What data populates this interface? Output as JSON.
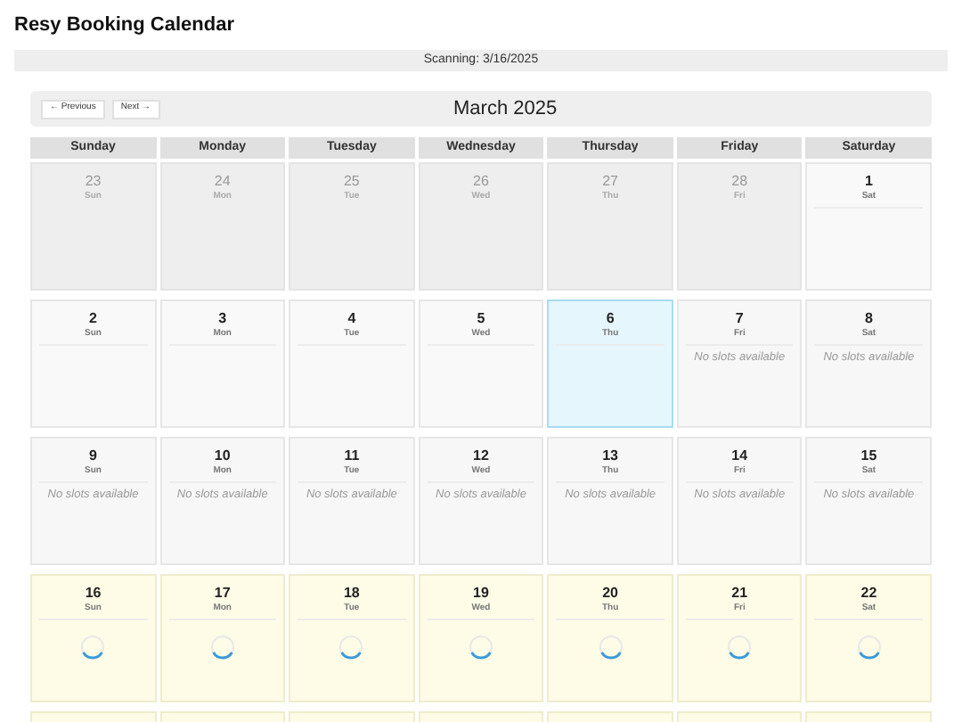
{
  "title": "Resy Booking Calendar",
  "status": "Scanning: 3/16/2025",
  "nav": {
    "previous": "← Previous",
    "next": "Next →",
    "month": "March 2025"
  },
  "weekdays": [
    "Sunday",
    "Monday",
    "Tuesday",
    "Wednesday",
    "Thursday",
    "Friday",
    "Saturday"
  ],
  "weeks": [
    [
      {
        "day": "23",
        "weekday": "Sun",
        "kind": "outside"
      },
      {
        "day": "24",
        "weekday": "Mon",
        "kind": "outside"
      },
      {
        "day": "25",
        "weekday": "Tue",
        "kind": "outside"
      },
      {
        "day": "26",
        "weekday": "Wed",
        "kind": "outside"
      },
      {
        "day": "27",
        "weekday": "Thu",
        "kind": "outside"
      },
      {
        "day": "28",
        "weekday": "Fri",
        "kind": "outside"
      },
      {
        "day": "1",
        "weekday": "Sat",
        "kind": "empty"
      }
    ],
    [
      {
        "day": "2",
        "weekday": "Sun",
        "kind": "empty"
      },
      {
        "day": "3",
        "weekday": "Mon",
        "kind": "empty"
      },
      {
        "day": "4",
        "weekday": "Tue",
        "kind": "empty"
      },
      {
        "day": "5",
        "weekday": "Wed",
        "kind": "empty"
      },
      {
        "day": "6",
        "weekday": "Thu",
        "kind": "today"
      },
      {
        "day": "7",
        "weekday": "Fri",
        "kind": "none",
        "note": "No slots available"
      },
      {
        "day": "8",
        "weekday": "Sat",
        "kind": "none",
        "note": "No slots available"
      }
    ],
    [
      {
        "day": "9",
        "weekday": "Sun",
        "kind": "none",
        "note": "No slots available"
      },
      {
        "day": "10",
        "weekday": "Mon",
        "kind": "none",
        "note": "No slots available"
      },
      {
        "day": "11",
        "weekday": "Tue",
        "kind": "none",
        "note": "No slots available"
      },
      {
        "day": "12",
        "weekday": "Wed",
        "kind": "none",
        "note": "No slots available"
      },
      {
        "day": "13",
        "weekday": "Thu",
        "kind": "none",
        "note": "No slots available"
      },
      {
        "day": "14",
        "weekday": "Fri",
        "kind": "none",
        "note": "No slots available"
      },
      {
        "day": "15",
        "weekday": "Sat",
        "kind": "none",
        "note": "No slots available"
      }
    ],
    [
      {
        "day": "16",
        "weekday": "Sun",
        "kind": "loading"
      },
      {
        "day": "17",
        "weekday": "Mon",
        "kind": "loading"
      },
      {
        "day": "18",
        "weekday": "Tue",
        "kind": "loading"
      },
      {
        "day": "19",
        "weekday": "Wed",
        "kind": "loading"
      },
      {
        "day": "20",
        "weekday": "Thu",
        "kind": "loading"
      },
      {
        "day": "21",
        "weekday": "Fri",
        "kind": "loading"
      },
      {
        "day": "22",
        "weekday": "Sat",
        "kind": "loading"
      }
    ],
    [
      {
        "kind": "loading"
      },
      {
        "kind": "loading"
      },
      {
        "kind": "loading"
      },
      {
        "kind": "loading"
      },
      {
        "kind": "loading"
      },
      {
        "kind": "loading"
      },
      {
        "kind": "loading"
      }
    ]
  ]
}
